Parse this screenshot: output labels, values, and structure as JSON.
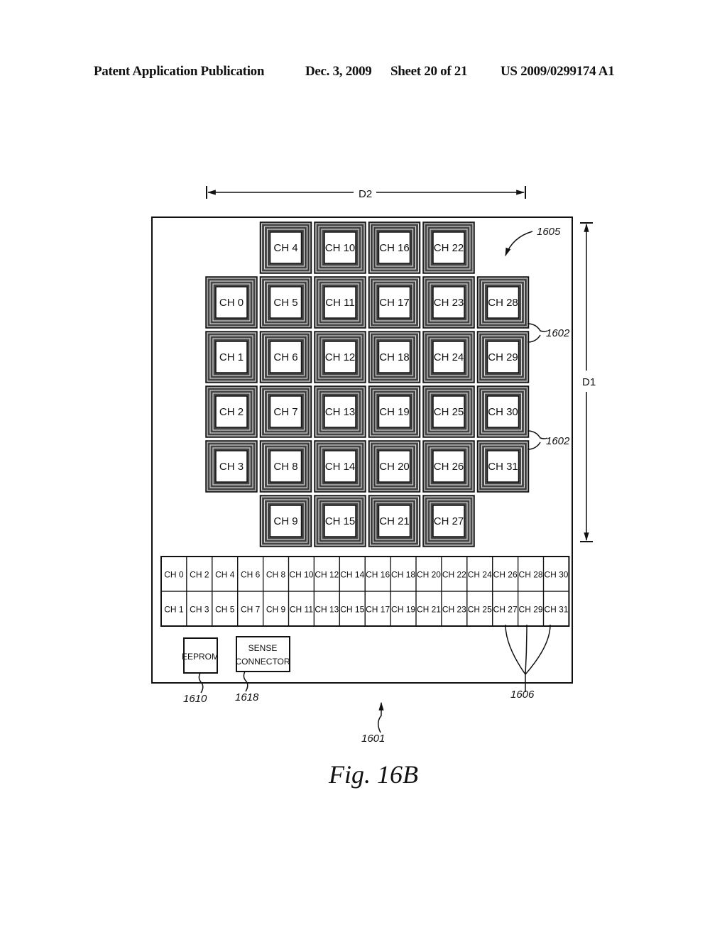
{
  "header": {
    "left": "Patent Application Publication",
    "date": "Dec. 3, 2009",
    "sheet": "Sheet 20 of 21",
    "number": "US 2009/0299174 A1"
  },
  "figure": {
    "caption": "Fig. 16B",
    "dimensions": {
      "width_label": "D2",
      "height_label": "D1"
    },
    "reference_numerals": {
      "board": "1601",
      "coil": "1602",
      "array": "1605",
      "connector_contacts": "1606",
      "eeprom": "1610",
      "sense_connector": "1618"
    },
    "components": {
      "eeprom": "EEPROM",
      "sense_connector": [
        "SENSE",
        "CONNECTOR"
      ]
    },
    "coil_grid": [
      [
        "",
        "CH 4",
        "CH 10",
        "CH 16",
        "CH 22",
        ""
      ],
      [
        "CH 0",
        "CH 5",
        "CH 11",
        "CH 17",
        "CH 23",
        "CH 28"
      ],
      [
        "CH 1",
        "CH 6",
        "CH 12",
        "CH 18",
        "CH 24",
        "CH 29"
      ],
      [
        "CH 2",
        "CH 7",
        "CH 13",
        "CH 19",
        "CH 25",
        "CH 30"
      ],
      [
        "CH 3",
        "CH 8",
        "CH 14",
        "CH 20",
        "CH 26",
        "CH 31"
      ],
      [
        "",
        "CH 9",
        "CH 15",
        "CH 21",
        "CH 27",
        ""
      ]
    ],
    "connector_rows": [
      [
        "CH 0",
        "CH 2",
        "CH 4",
        "CH 6",
        "CH 8",
        "CH 10",
        "CH 12",
        "CH 14",
        "CH 16",
        "CH 18",
        "CH 20",
        "CH 22",
        "CH 24",
        "CH 26",
        "CH 28",
        "CH 30"
      ],
      [
        "CH 1",
        "CH 3",
        "CH 5",
        "CH 7",
        "CH 9",
        "CH 11",
        "CH 13",
        "CH 15",
        "CH 17",
        "CH 19",
        "CH 21",
        "CH 23",
        "CH 25",
        "CH 27",
        "CH 29",
        "CH 31"
      ]
    ]
  }
}
